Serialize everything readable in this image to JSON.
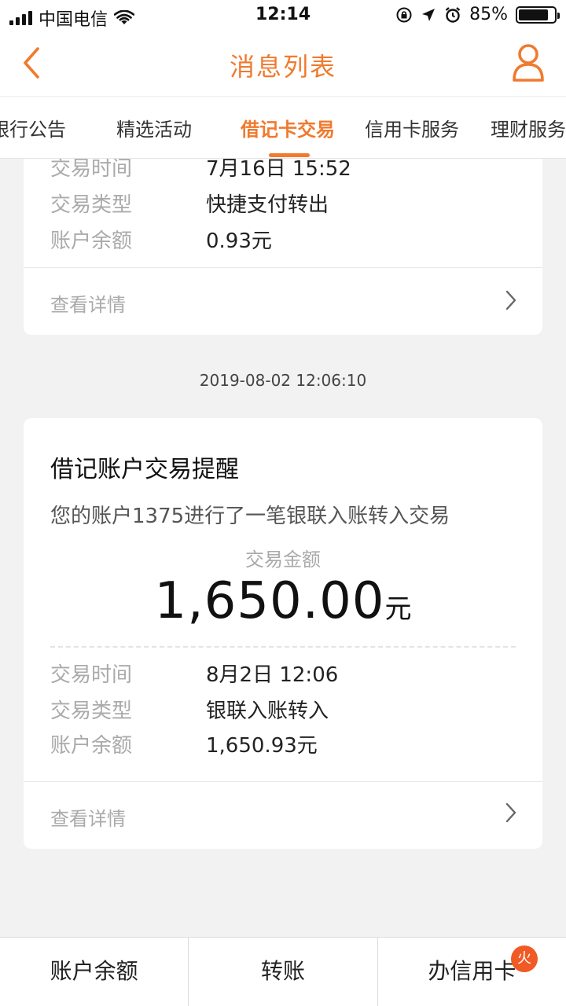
{
  "status_bar": {
    "carrier": "中国电信",
    "time": "12:14",
    "battery": "85%",
    "battery_level": 0.85
  },
  "nav": {
    "title": "消息列表"
  },
  "tabs": [
    {
      "label": "银行公告",
      "active": false
    },
    {
      "label": "精选活动",
      "active": false
    },
    {
      "label": "借记卡交易",
      "active": true
    },
    {
      "label": "信用卡服务",
      "active": false
    },
    {
      "label": "理财服务",
      "active": false
    }
  ],
  "card1": {
    "rows": [
      {
        "label": "交易时间",
        "value": "7月16日 15:52"
      },
      {
        "label": "交易类型",
        "value": "快捷支付转出"
      },
      {
        "label": "账户余额",
        "value": "0.93元"
      }
    ],
    "detail_label": "查看详情"
  },
  "timestamp2": "2019-08-02 12:06:10",
  "card2": {
    "title": "借记账户交易提醒",
    "description": "您的账户1375进行了一笔银联入账转入交易",
    "amount_label": "交易金额",
    "amount": "1,650.00",
    "amount_unit": "元",
    "rows": [
      {
        "label": "交易时间",
        "value": "8月2日 12:06"
      },
      {
        "label": "交易类型",
        "value": "银联入账转入"
      },
      {
        "label": "账户余额",
        "value": "1,650.93元"
      }
    ],
    "detail_label": "查看详情"
  },
  "bottom_bar": {
    "items": [
      "账户余额",
      "转账",
      "办信用卡"
    ],
    "badge": "火"
  },
  "colors": {
    "accent": "#f07a2e",
    "badge": "#f05a24"
  }
}
